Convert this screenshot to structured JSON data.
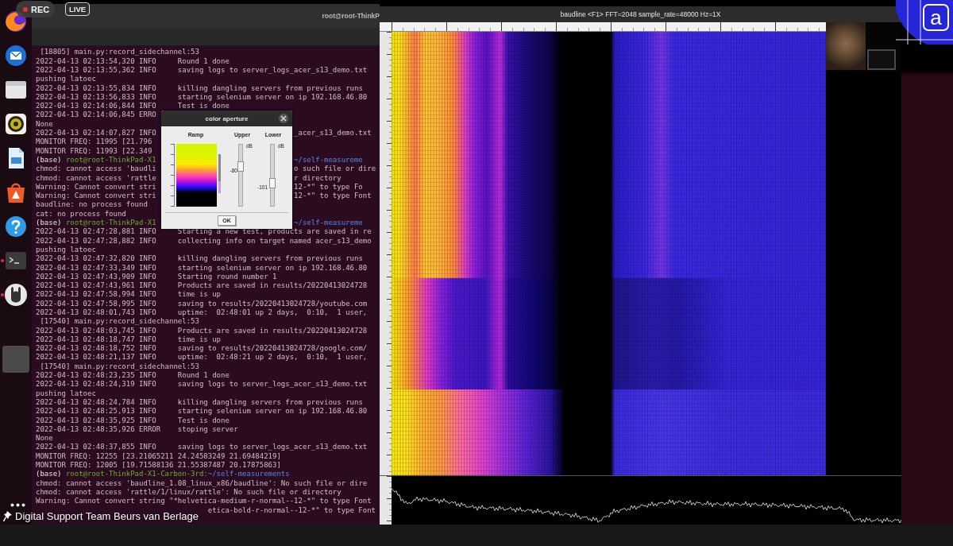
{
  "overlay": {
    "rec": "REC",
    "live": "LIVE",
    "caption": "Digital Support Team Beurs van Berlage"
  },
  "dock": {
    "items": [
      {
        "kind": "browser",
        "running": false
      },
      {
        "kind": "mail",
        "running": false
      },
      {
        "kind": "files",
        "running": false
      },
      {
        "kind": "music",
        "running": false
      },
      {
        "kind": "document",
        "running": false
      },
      {
        "kind": "store",
        "running": false
      },
      {
        "kind": "help",
        "running": false
      },
      {
        "kind": "terminal",
        "running": true
      },
      {
        "kind": "emblem",
        "running": true
      },
      {
        "kind": "tile",
        "running": false
      }
    ]
  },
  "terminal": {
    "title": "root@root-ThinkP",
    "lines": [
      {
        "kind": "thread",
        "text": "[18805] main.py:record_sidechannel:53"
      },
      {
        "kind": "log",
        "text": "2022-04-13 02:13:54,320 INFO     Round 1 done"
      },
      {
        "kind": "log",
        "text": "2022-04-13 02:13:55,362 INFO     saving logs to server_logs_acer_s13_demo.txt"
      },
      {
        "kind": "log",
        "text": "pushing latoec"
      },
      {
        "kind": "log",
        "text": "2022-04-13 02:13:55,834 INFO     killing dangling servers from previous runs"
      },
      {
        "kind": "log",
        "text": "2022-04-13 02:13:56,833 INFO     starting selenium server on ip 192.168.46.80"
      },
      {
        "kind": "log",
        "text": "2022-04-13 02:14:06,844 INFO     Test is done"
      },
      {
        "kind": "log",
        "text": "2022-04-13 02:14:06,845 ERRO"
      },
      {
        "kind": "log",
        "text": "None"
      },
      {
        "kind": "log",
        "text": "2022-04-13 02:14:07,827 INFO",
        "tail": "_acer_s13_demo.txt"
      },
      {
        "kind": "log",
        "text": "MONITOR FREQ: 11995 [21.796"
      },
      {
        "kind": "log",
        "text": "MONITOR FREQ: 11993 [22.349"
      },
      {
        "kind": "prompt",
        "env": "(base)",
        "user": "root@root-ThinkPad-X1",
        "tail": "~/self-measureme"
      },
      {
        "kind": "log",
        "text": "chmod: cannot access 'baudli",
        "tail": "o such file or dire"
      },
      {
        "kind": "log",
        "text": "chmod: cannot access 'rattle",
        "tail": "r directory"
      },
      {
        "kind": "log",
        "text": "Warning: Cannot convert stri",
        "tail": "12-*\" to type Fo"
      },
      {
        "kind": "log",
        "text": "Warning: Cannot convert stri",
        "tail": "12-*\" to type Font"
      },
      {
        "kind": "log",
        "text": "baudline: no process found"
      },
      {
        "kind": "log",
        "text": "cat: no process found"
      },
      {
        "kind": "prompt",
        "env": "(base)",
        "user": "root@root-ThinkPad-X1",
        "tail": "~/self-measureme"
      },
      {
        "kind": "log",
        "text": "2022-04-13 02:47:28,881 INFO     Starting a new test, products are saved in re"
      },
      {
        "kind": "log",
        "text": "2022-04-13 02:47:28,882 INFO     collecting info on target named acer_s13_demo"
      },
      {
        "kind": "log",
        "text": "pushing latoec"
      },
      {
        "kind": "log",
        "text": "2022-04-13 02:47:32,820 INFO     killing dangling servers from previous runs"
      },
      {
        "kind": "log",
        "text": "2022-04-13 02:47:33,349 INFO     starting selenium server on ip 192.168.46.80"
      },
      {
        "kind": "log",
        "text": "2022-04-13 02:47:43,909 INFO     Starting round number 1"
      },
      {
        "kind": "log",
        "text": "2022-04-13 02:47:43,961 INFO     Products are saved in results/20220413024728"
      },
      {
        "kind": "log",
        "text": "2022-04-13 02:47:58,994 INFO     time is up"
      },
      {
        "kind": "log",
        "text": "2022-04-13 02:47:58,995 INFO     saving to results/20220413024728/youtube.com"
      },
      {
        "kind": "log",
        "text": "2022-04-13 02:48:01,743 INFO     uptime:  02:48:01 up 2 days,  0:10,  1 user,"
      },
      {
        "kind": "thread",
        "text": "[17540] main.py:record_sidechannel:53"
      },
      {
        "kind": "log",
        "text": "2022-04-13 02:48:03,745 INFO     Products are saved in results/20220413024728"
      },
      {
        "kind": "log",
        "text": "2022-04-13 02:48:18,747 INFO     time is up"
      },
      {
        "kind": "log",
        "text": "2022-04-13 02:48:18,752 INFO     saving to results/20220413024728/google.com/"
      },
      {
        "kind": "log",
        "text": "2022-04-13 02:48:21,137 INFO     uptime:  02:48:21 up 2 days,  0:10,  1 user,"
      },
      {
        "kind": "thread",
        "text": "[17540] main.py:record_sidechannel:53"
      },
      {
        "kind": "log",
        "text": "2022-04-13 02:48:23,235 INFO     Round 1 done"
      },
      {
        "kind": "log",
        "text": "2022-04-13 02:48:24,319 INFO     saving logs to server_logs_acer_s13_demo.txt"
      },
      {
        "kind": "log",
        "text": "pushing latoec"
      },
      {
        "kind": "log",
        "text": "2022-04-13 02:48:24,784 INFO     killing dangling servers from previous runs"
      },
      {
        "kind": "log",
        "text": "2022-04-13 02:48:25,913 INFO     starting selenium server on ip 192.168.46.80"
      },
      {
        "kind": "log",
        "text": "2022-04-13 02:48:35,925 INFO     Test is done"
      },
      {
        "kind": "log",
        "text": "2022-04-13 02:48:35,926 ERROR    stoping server"
      },
      {
        "kind": "log",
        "text": "None"
      },
      {
        "kind": "log",
        "text": "2022-04-13 02:48:37,855 INFO     saving logs to server_logs_acer_s13_demo.txt"
      },
      {
        "kind": "log",
        "text": "MONITOR FREQ: 12255 [23.21065211 24.24583249 21.69484219]"
      },
      {
        "kind": "log",
        "text": "MONITOR FREQ: 12005 [19.71588136 21.55387487 20.17875863]"
      },
      {
        "kind": "prompt",
        "env": "(base)",
        "user": "root@root-ThinkPad-X1-Carbon-3rd:",
        "path": "~/self-measurements"
      },
      {
        "kind": "log",
        "text": "chmod: cannot access 'baudline_1.08_linux_x86/baudline': No such file or dire"
      },
      {
        "kind": "log",
        "text": "chmod: cannot access 'rattle/1/linux/rattle': No such file or directory"
      },
      {
        "kind": "log",
        "text": "Warning: Cannot convert string \"*helvetica-medium-r-normal--12-*\" to type Font"
      },
      {
        "kind": "log",
        "tail": "etica-bold-r-normal--12-*\" to type Font"
      }
    ]
  },
  "dialog": {
    "title": "color aperture",
    "columns": [
      "Ramp",
      "Upper",
      "Lower"
    ],
    "sliders": [
      {
        "unit": "dB",
        "value": "-80",
        "level": 0.65
      },
      {
        "unit": "dB",
        "value": "-101",
        "level": 0.33
      }
    ],
    "button": "OK"
  },
  "baudline": {
    "title": "baudline <F1> FFT=2048 sample_rate=48000 Hz=1X"
  },
  "logo": {
    "letter": "a"
  }
}
